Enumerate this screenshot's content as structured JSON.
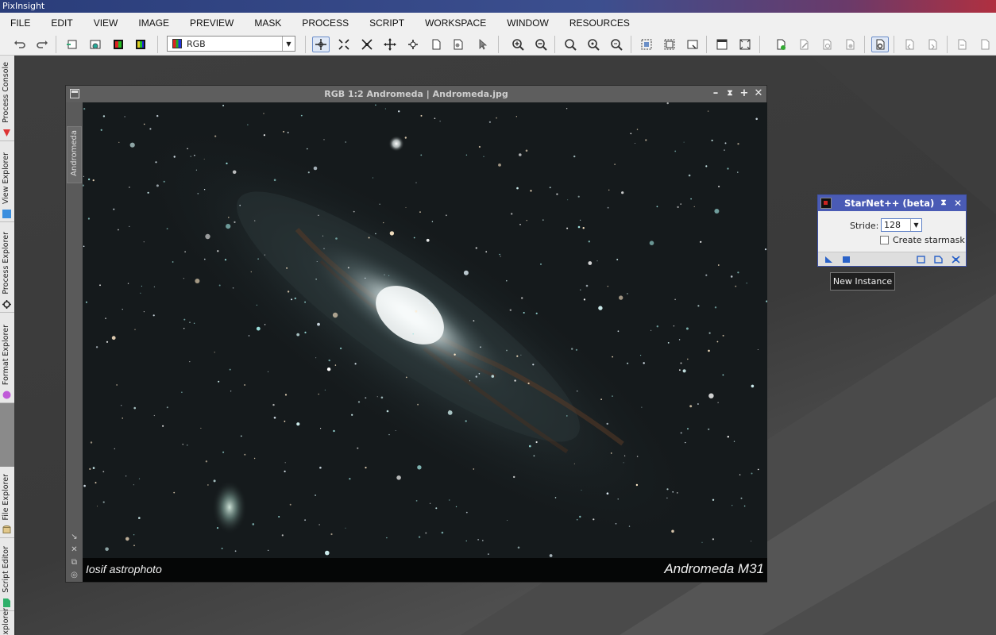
{
  "window": {
    "title": "PixInsight"
  },
  "menu": [
    "FILE",
    "EDIT",
    "VIEW",
    "IMAGE",
    "PREVIEW",
    "MASK",
    "PROCESS",
    "SCRIPT",
    "WORKSPACE",
    "WINDOW",
    "RESOURCES"
  ],
  "toolbar": {
    "channel_select": "RGB"
  },
  "dock": {
    "tabs": [
      "Process Console",
      "View Explorer",
      "Process Explorer",
      "Format Explorer",
      "File Explorer",
      "Script Editor",
      "xplorer"
    ]
  },
  "image_window": {
    "title": "RGB 1:2 Andromeda | Andromeda.jpg",
    "view_tab": "Andromeda",
    "caption_left": "Iosif astrophoto",
    "caption_right": "Andromeda M31"
  },
  "starnet": {
    "title": "StarNet++ (beta)",
    "stride_label": "Stride:",
    "stride_value": "128",
    "starmask_label": "Create starmask",
    "starmask_checked": false
  },
  "tooltip": {
    "text": "New Instance"
  },
  "colors": {
    "panel_title": "#4a5bb5",
    "toolbar_bg": "#f0f0f0",
    "workspace_bg": "#3a3a3a"
  }
}
